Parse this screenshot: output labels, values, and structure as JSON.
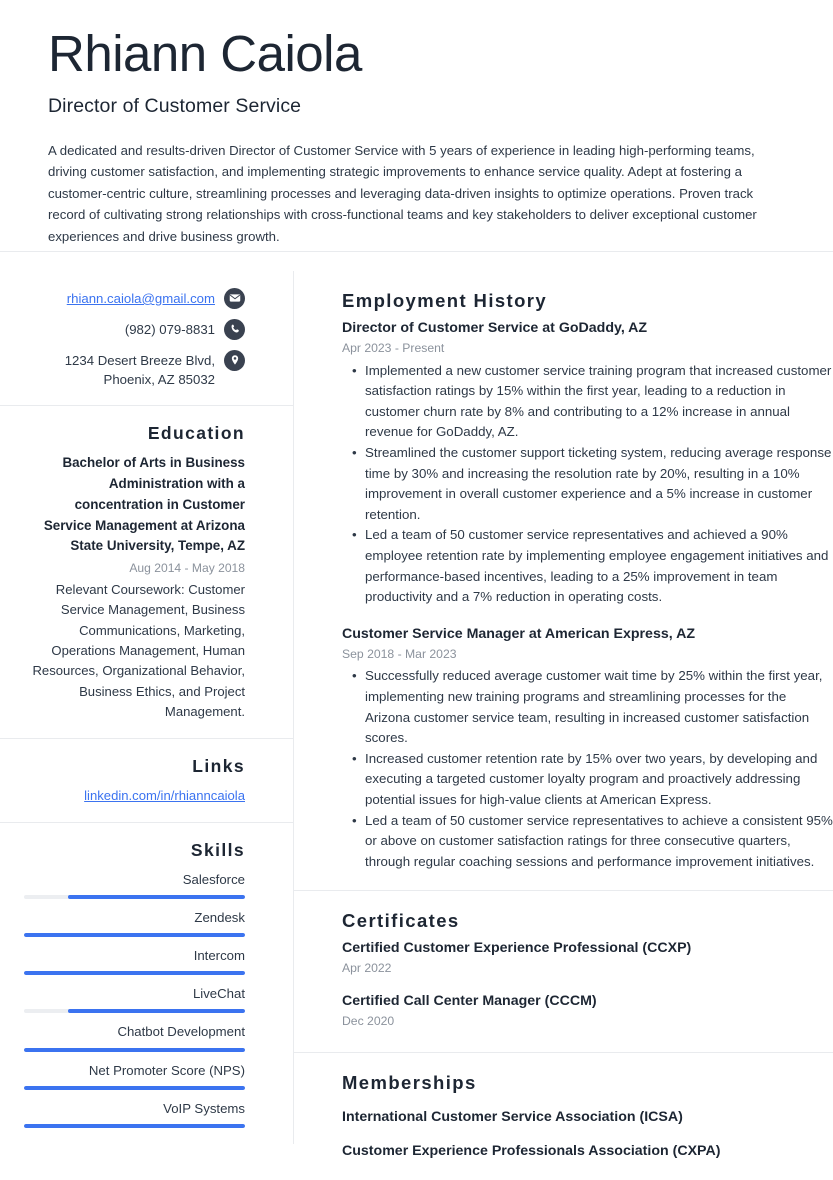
{
  "header": {
    "name": "Rhiann Caiola",
    "job_title": "Director of Customer Service",
    "summary": "A dedicated and results-driven Director of Customer Service with 5 years of experience in leading high-performing teams, driving customer satisfaction, and implementing strategic improvements to enhance service quality. Adept at fostering a customer-centric culture, streamlining processes and leveraging data-driven insights to optimize operations. Proven track record of cultivating strong relationships with cross-functional teams and key stakeholders to deliver exceptional customer experiences and drive business growth."
  },
  "contact": {
    "email": "rhiann.caiola@gmail.com",
    "phone": "(982) 079-8831",
    "address": "1234 Desert Breeze Blvd, Phoenix, AZ 85032",
    "icons": {
      "email": "envelope-icon",
      "phone": "phone-icon",
      "address": "location-pin-icon"
    }
  },
  "education": {
    "heading": "Education",
    "degree": "Bachelor of Arts in Business Administration with a concentration in Customer Service Management at Arizona State University, Tempe, AZ",
    "date": "Aug 2014 - May 2018",
    "description": "Relevant Coursework: Customer Service Management, Business Communications, Marketing, Operations Management, Human Resources, Organizational Behavior, Business Ethics, and Project Management."
  },
  "links": {
    "heading": "Links",
    "items": [
      {
        "label": "linkedin.com/in/rhianncaiola"
      }
    ]
  },
  "skills": {
    "heading": "Skills",
    "items": [
      {
        "name": "Salesforce",
        "level": 80
      },
      {
        "name": "Zendesk",
        "level": 100
      },
      {
        "name": "Intercom",
        "level": 100
      },
      {
        "name": "LiveChat",
        "level": 80
      },
      {
        "name": "Chatbot Development",
        "level": 100
      },
      {
        "name": "Net Promoter Score (NPS)",
        "level": 100
      },
      {
        "name": "VoIP Systems",
        "level": 100
      }
    ]
  },
  "employment": {
    "heading": "Employment History",
    "entries": [
      {
        "title": "Director of Customer Service at GoDaddy, AZ",
        "date": "Apr 2023 - Present",
        "bullets": [
          "Implemented a new customer service training program that increased customer satisfaction ratings by 15% within the first year, leading to a reduction in customer churn rate by 8% and contributing to a 12% increase in annual revenue for GoDaddy, AZ.",
          "Streamlined the customer support ticketing system, reducing average response time by 30% and increasing the resolution rate by 20%, resulting in a 10% improvement in overall customer experience and a 5% increase in customer retention.",
          "Led a team of 50 customer service representatives and achieved a 90% employee retention rate by implementing employee engagement initiatives and performance-based incentives, leading to a 25% improvement in team productivity and a 7% reduction in operating costs."
        ]
      },
      {
        "title": "Customer Service Manager at American Express, AZ",
        "date": "Sep 2018 - Mar 2023",
        "bullets": [
          "Successfully reduced average customer wait time by 25% within the first year, implementing new training programs and streamlining processes for the Arizona customer service team, resulting in increased customer satisfaction scores.",
          "Increased customer retention rate by 15% over two years, by developing and executing a targeted customer loyalty program and proactively addressing potential issues for high-value clients at American Express.",
          "Led a team of 50 customer service representatives to achieve a consistent 95% or above on customer satisfaction ratings for three consecutive quarters, through regular coaching sessions and performance improvement initiatives."
        ]
      }
    ]
  },
  "certificates": {
    "heading": "Certificates",
    "entries": [
      {
        "title": "Certified Customer Experience Professional (CCXP)",
        "date": "Apr 2022"
      },
      {
        "title": "Certified Call Center Manager (CCCM)",
        "date": "Dec 2020"
      }
    ]
  },
  "memberships": {
    "heading": "Memberships",
    "entries": [
      {
        "title": "International Customer Service Association (ICSA)"
      },
      {
        "title": "Customer Experience Professionals Association (CXPA)"
      }
    ]
  },
  "colors": {
    "accent_blue": "#3b73f0",
    "heading_dark": "#1d2633",
    "body_text": "#2e3947",
    "muted_text": "#8b929c",
    "divider": "#e9ebee",
    "icon_circle": "#3a4250",
    "skill_track": "#eceef1"
  }
}
